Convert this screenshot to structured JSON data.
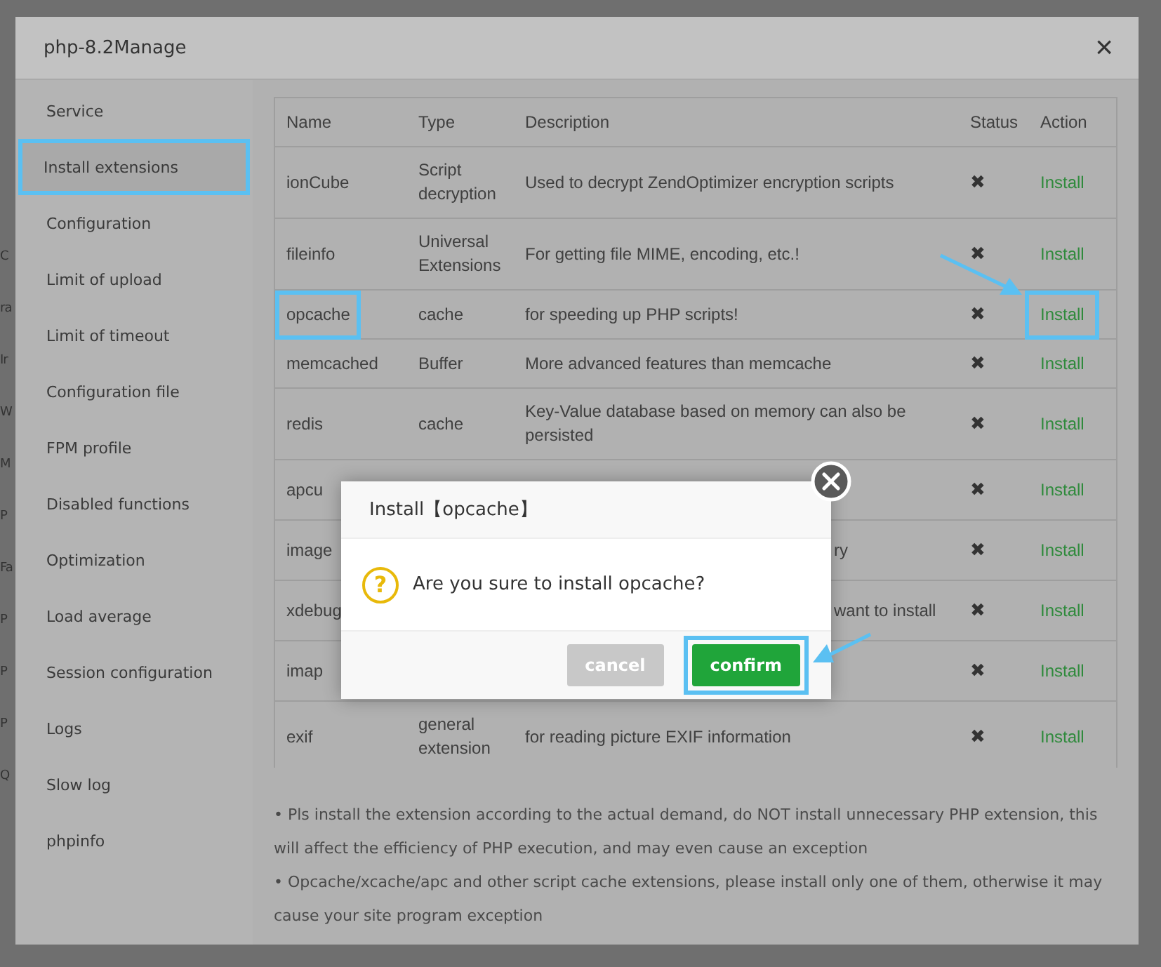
{
  "background_page": {
    "items": [
      "C",
      "ra",
      "Ir",
      "W",
      "M",
      "P",
      "Fa",
      "P",
      "P",
      "P",
      "Q"
    ]
  },
  "modal": {
    "title": "php-8.2Manage",
    "close": "×"
  },
  "sidebar": {
    "items": [
      {
        "label": "Service",
        "selected": false
      },
      {
        "label": "Install extensions",
        "selected": true
      },
      {
        "label": "Configuration",
        "selected": false
      },
      {
        "label": "Limit of upload",
        "selected": false
      },
      {
        "label": "Limit of timeout",
        "selected": false
      },
      {
        "label": "Configuration file",
        "selected": false
      },
      {
        "label": "FPM profile",
        "selected": false
      },
      {
        "label": "Disabled functions",
        "selected": false
      },
      {
        "label": "Optimization",
        "selected": false
      },
      {
        "label": "Load average",
        "selected": false
      },
      {
        "label": "Session configuration",
        "selected": false
      },
      {
        "label": "Logs",
        "selected": false
      },
      {
        "label": "Slow log",
        "selected": false
      },
      {
        "label": "phpinfo",
        "selected": false
      }
    ]
  },
  "table": {
    "columns": [
      "Name",
      "Type",
      "Description",
      "Status",
      "Action"
    ],
    "rows": [
      {
        "name": "ionCube",
        "type": "Script decryption",
        "description": "Used to decrypt ZendOptimizer encryption scripts",
        "status": "✖",
        "action": "Install",
        "marked": false,
        "covered": false
      },
      {
        "name": "fileinfo",
        "type": "Universal Extensions",
        "description": "For getting file MIME, encoding, etc.!",
        "status": "✖",
        "action": "Install",
        "marked": false,
        "covered": false
      },
      {
        "name": "opcache",
        "type": "cache",
        "description": "for speeding up PHP scripts!",
        "status": "✖",
        "action": "Install",
        "marked": true,
        "covered": false
      },
      {
        "name": "memcached",
        "type": "Buffer",
        "description": "More advanced features than memcache",
        "status": "✖",
        "action": "Install",
        "marked": false,
        "covered": false
      },
      {
        "name": "redis",
        "type": "cache",
        "description": "Key-Value database based on memory can also be persisted",
        "status": "✖",
        "action": "Install",
        "marked": false,
        "covered": false
      },
      {
        "name": "apcu",
        "status": "✖",
        "action": "Install",
        "marked": false,
        "covered": true
      },
      {
        "name": "image",
        "description": "ry",
        "status": "✖",
        "action": "Install",
        "marked": false,
        "covered": true
      },
      {
        "name": "xdebug",
        "description": "want to install",
        "status": "✖",
        "action": "Install",
        "marked": false,
        "covered": true
      },
      {
        "name": "imap",
        "status": "✖",
        "action": "Install",
        "marked": false,
        "covered": true
      },
      {
        "name": "exif",
        "type": "general extension",
        "description": "for reading picture EXIF information",
        "status": "✖",
        "action": "Install",
        "marked": false,
        "covered": false
      }
    ]
  },
  "notes": [
    "• Pls install the extension according to the actual demand, do NOT install unnecessary PHP extension, this will affect the efficiency of PHP execution, and may even cause an exception",
    "• Opcache/xcache/apc and other script cache extensions, please install only one of them, otherwise it may cause your site program exception"
  ],
  "dialog": {
    "title": "Install【opcache】",
    "icon": "?",
    "message": "Are you sure to install opcache?",
    "buttons": [
      {
        "label": "cancel",
        "kind": "cancel",
        "marked": false
      },
      {
        "label": "confirm",
        "kind": "confirm",
        "marked": true
      }
    ]
  }
}
